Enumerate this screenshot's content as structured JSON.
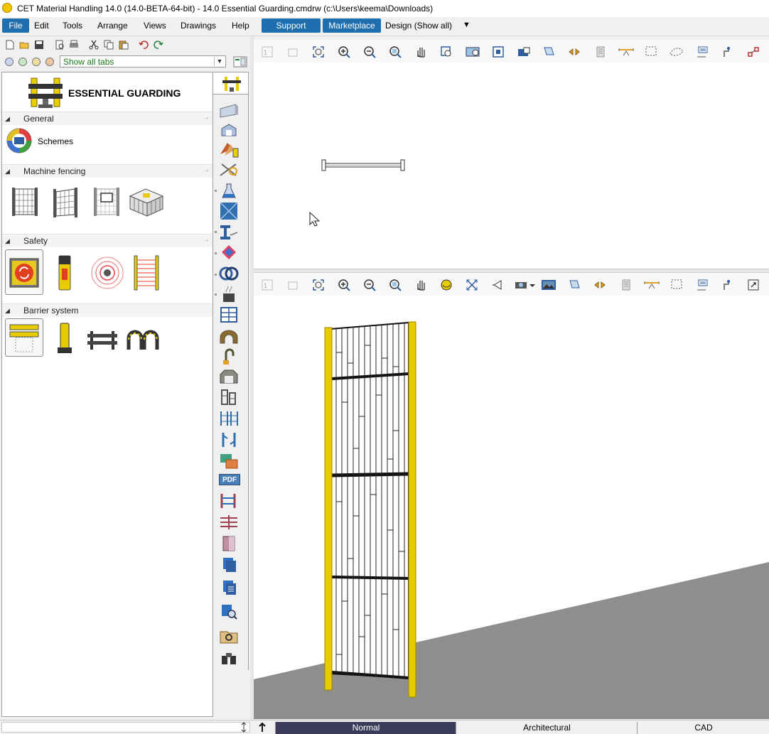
{
  "window": {
    "title": "CET Material Handling 14.0 (14.0-BETA-64-bit) - 14.0 Essential Guarding.cmdrw (c:\\Users\\keema\\Downloads)"
  },
  "menu": {
    "items": [
      "File",
      "Edit",
      "Tools",
      "Arrange",
      "Views",
      "Drawings",
      "Help"
    ],
    "support": "Support",
    "marketplace": "Marketplace",
    "design": "Design (Show all)"
  },
  "tabs_filter": {
    "selected": "Show all tabs"
  },
  "catalog": {
    "title": "ESSENTIAL GUARDING",
    "sections": [
      {
        "label": "General"
      },
      {
        "label": "Machine fencing"
      },
      {
        "label": "Safety"
      },
      {
        "label": "Barrier system"
      }
    ],
    "general_item": "Schemes"
  },
  "status": {
    "tabs": [
      "Normal",
      "Architectural",
      "CAD"
    ]
  },
  "colors": {
    "accent": "#1f6fb0",
    "guard_yellow": "#e6cc00",
    "floor": "#8e8e8e",
    "active_tab": "#3c3a5a"
  }
}
